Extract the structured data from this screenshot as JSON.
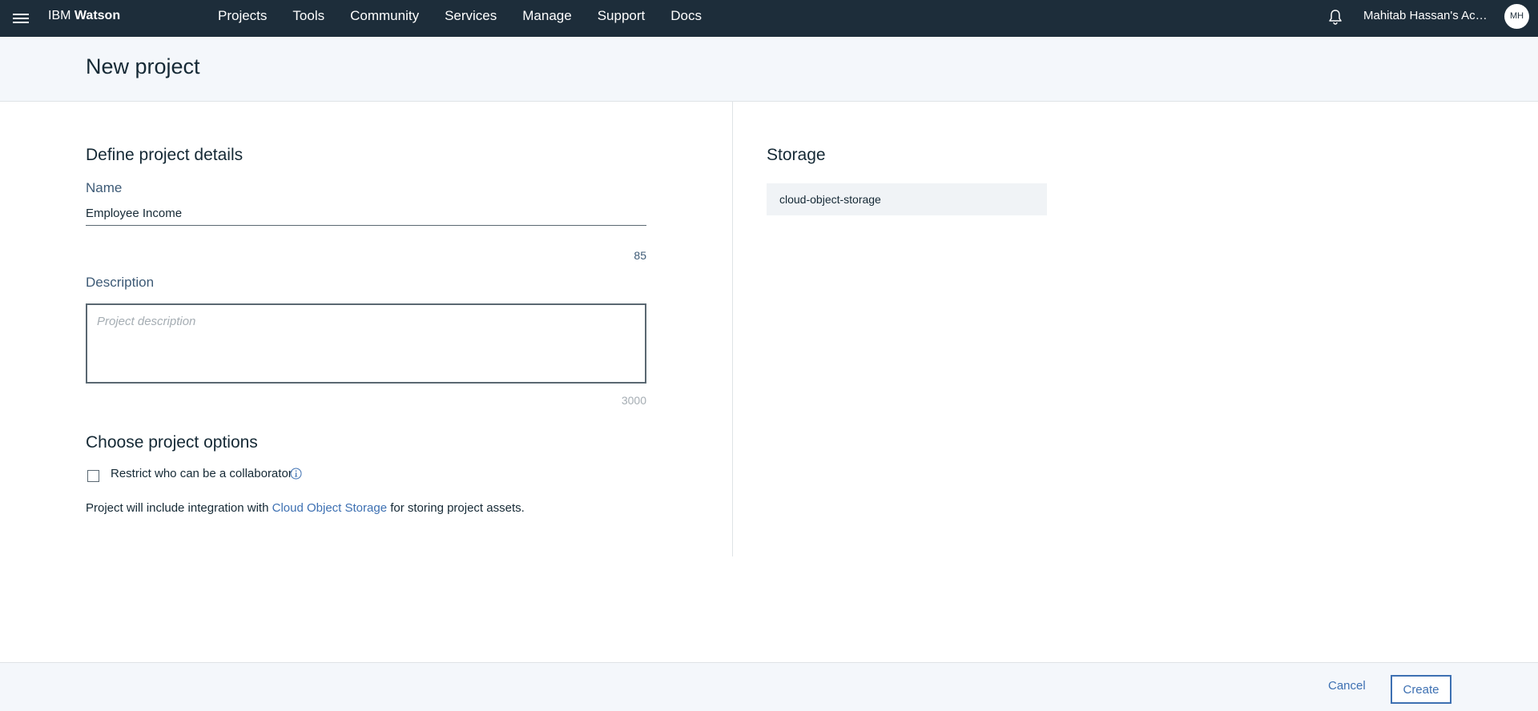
{
  "topbar": {
    "brand_prefix": "IBM",
    "brand_name": "Watson",
    "nav": [
      {
        "label": "Projects"
      },
      {
        "label": "Tools"
      },
      {
        "label": "Community"
      },
      {
        "label": "Services"
      },
      {
        "label": "Manage"
      },
      {
        "label": "Support"
      },
      {
        "label": "Docs"
      }
    ],
    "account_label": "Mahitab Hassan's Acco...",
    "avatar_initials": "MH"
  },
  "page": {
    "title": "New project"
  },
  "details": {
    "section_title": "Define project details",
    "name_label": "Name",
    "name_value": "Employee Income",
    "name_counter": "85",
    "description_label": "Description",
    "description_placeholder": "Project description",
    "description_counter": "3000"
  },
  "options": {
    "section_title": "Choose project options",
    "restrict_label": "Restrict who can be a collaborator",
    "integration_prefix": "Project will include integration with",
    "integration_link": "Cloud Object Storage",
    "integration_suffix": "for storing project assets."
  },
  "storage": {
    "section_title": "Storage",
    "selected": "cloud-object-storage"
  },
  "footer": {
    "cancel_label": "Cancel",
    "create_label": "Create"
  },
  "colors": {
    "topbar_bg": "#1d2d3a",
    "accent": "#3d70b2",
    "header_bg": "#f4f7fb"
  }
}
